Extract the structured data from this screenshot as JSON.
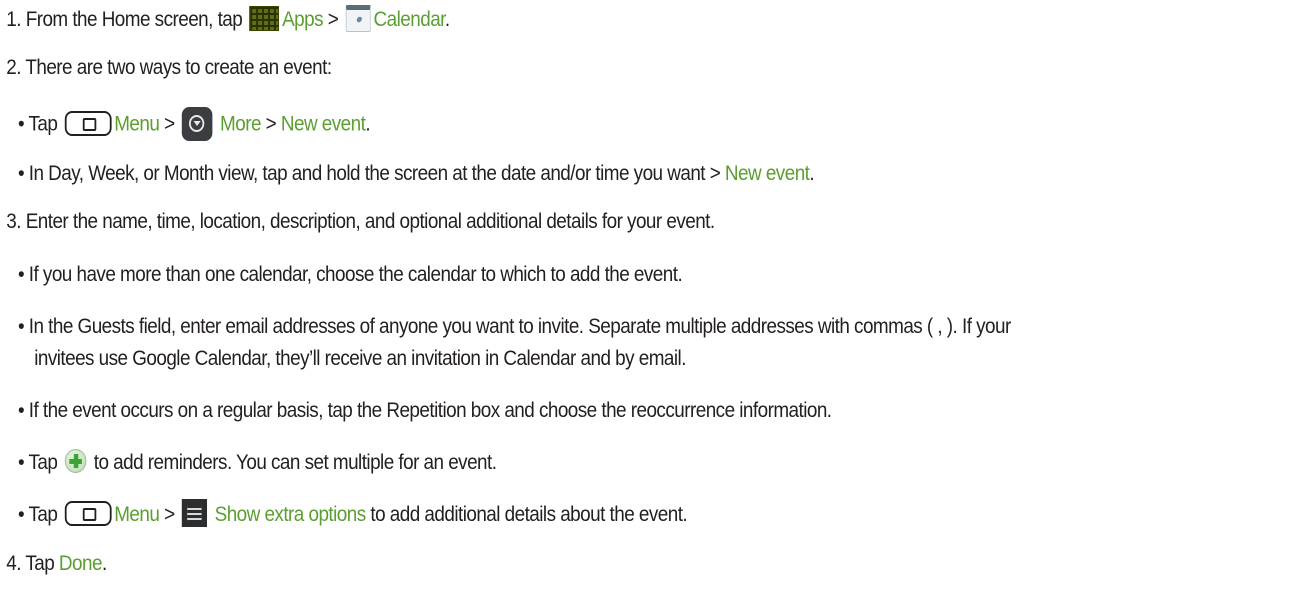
{
  "instructions": {
    "step1": {
      "prefix": "1. From the Home screen, tap",
      "apps_label": "Apps",
      "sep": ">",
      "calendar_label": "Calendar",
      "suffix": "."
    },
    "step2": {
      "text": "2. There are two ways to create an event:",
      "way1": {
        "prefix": "• Tap",
        "menu_label": "Menu",
        "sep1": ">",
        "more_label": "More",
        "sep2": ">",
        "new_event_label": "New event",
        "suffix": "."
      },
      "way2": {
        "prefix": "• In Day, Week, or Month view, tap and hold the screen at the date and/or time you want >",
        "new_event_label": "New event",
        "suffix": "."
      }
    },
    "step3": {
      "text": "3. Enter the name, time, location, description, and optional additional details for your event.",
      "bullet1": "• If you have more than one calendar, choose the calendar to which to add the event.",
      "bullet2_line1": "• In the Guests field, enter email addresses of anyone you want to invite. Separate multiple addresses with commas ( , ). If your",
      "bullet2_line2": "invitees use Google Calendar, they’ll receive an invitation in Calendar and by email.",
      "bullet3": "• If the event occurs on a regular basis, tap the Repetition box and choose the reoccurrence information.",
      "bullet4": {
        "prefix": "• Tap",
        "suffix": "to add reminders. You can set multiple for an event."
      },
      "bullet5": {
        "prefix": "• Tap",
        "menu_label": "Menu",
        "sep": ">",
        "extra_label": "Show extra options",
        "suffix": "to add additional details about the event."
      }
    },
    "step4": {
      "prefix": "4. Tap",
      "done_label": "Done",
      "suffix": "."
    }
  },
  "colors": {
    "text": "#231f20",
    "link_green": "#5c9e31"
  },
  "icons": {
    "apps": "apps-grid-icon",
    "calendar": "calendar-icon",
    "menu": "menu-key-icon",
    "more": "more-icon",
    "add": "add-reminder-icon",
    "extra": "show-extra-options-icon"
  }
}
